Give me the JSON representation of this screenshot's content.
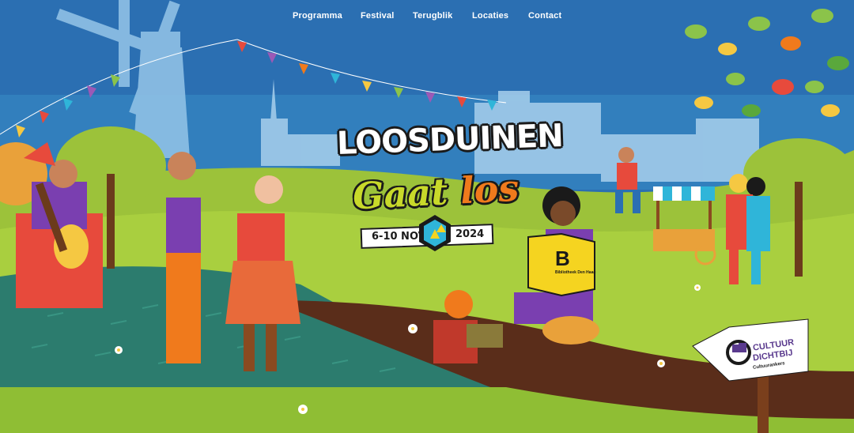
{
  "nav": {
    "items": [
      {
        "label": "Programma"
      },
      {
        "label": "Festival"
      },
      {
        "label": "Terugblik"
      },
      {
        "label": "Locaties"
      },
      {
        "label": "Contact"
      }
    ]
  },
  "logo": {
    "line1": "LOOSDUINEN",
    "line2_a": "Gaat",
    "line2_b": "los",
    "date_left": "6-10 NOV",
    "date_right": "2024"
  },
  "book": {
    "letter": "B",
    "small_text": "Bibliotheek Den Haag"
  },
  "signpost": {
    "brand_line1": "CULTUUR",
    "brand_line2": "DICHTBIJ",
    "sub": "Cultuurankers"
  },
  "colors": {
    "sky": "#2b6fb2",
    "grass_light": "#9cc23a",
    "grass_dark": "#2c7c6e",
    "path": "#5a2d1a",
    "logo_green": "#c8d92a",
    "logo_orange": "#f07a1c",
    "brand_purple": "#5a3a8e"
  }
}
